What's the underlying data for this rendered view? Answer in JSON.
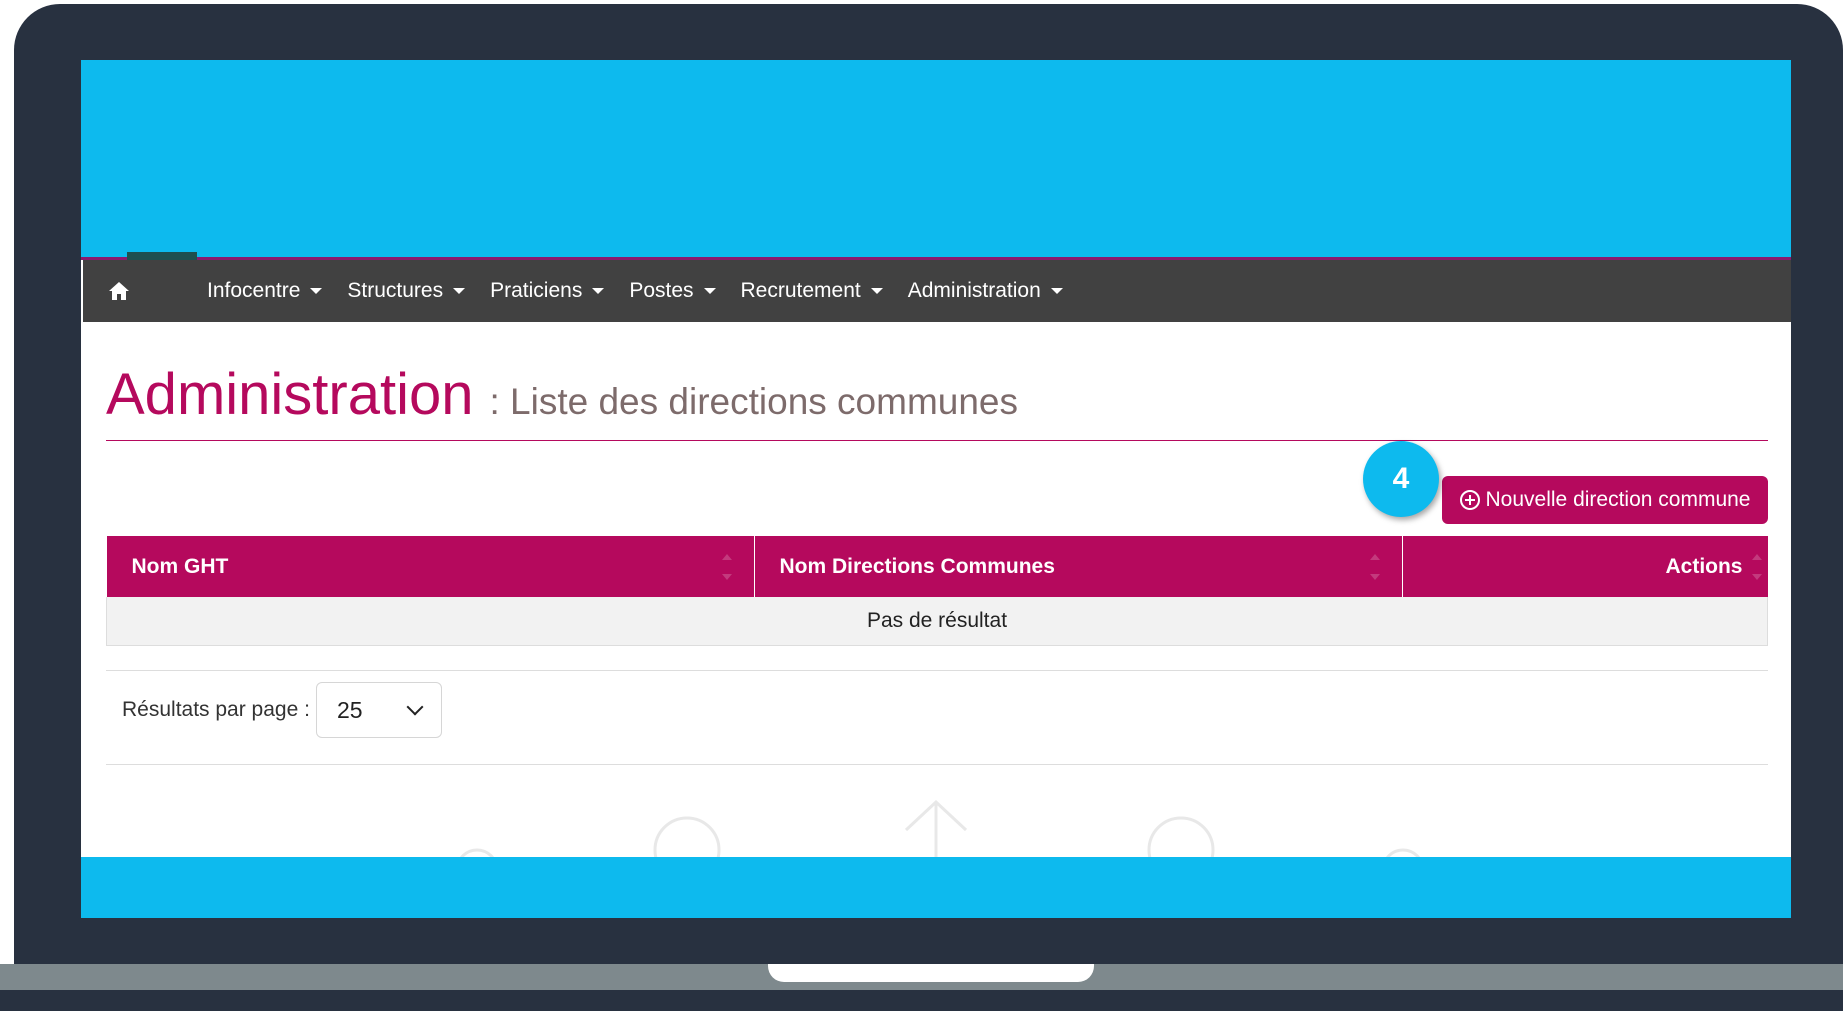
{
  "colors": {
    "brand": "#b5095d",
    "banner": "#0dbaee",
    "navbar": "#414141",
    "frame": "#283140"
  },
  "nav": {
    "home_icon": "home-icon",
    "items": [
      {
        "label": "Infocentre"
      },
      {
        "label": "Structures"
      },
      {
        "label": "Praticiens"
      },
      {
        "label": "Postes"
      },
      {
        "label": "Recrutement"
      },
      {
        "label": "Administration"
      }
    ]
  },
  "header": {
    "title": "Administration",
    "subtitle": ": Liste des directions communes"
  },
  "step_badge": "4",
  "new_button": {
    "label": "Nouvelle direction commune",
    "icon": "plus-circle-icon"
  },
  "table": {
    "columns": [
      "Nom GHT",
      "Nom Directions Communes",
      "Actions"
    ],
    "empty_message": "Pas de résultat"
  },
  "pagination": {
    "label": "Résultats par page :",
    "page_size": "25"
  }
}
